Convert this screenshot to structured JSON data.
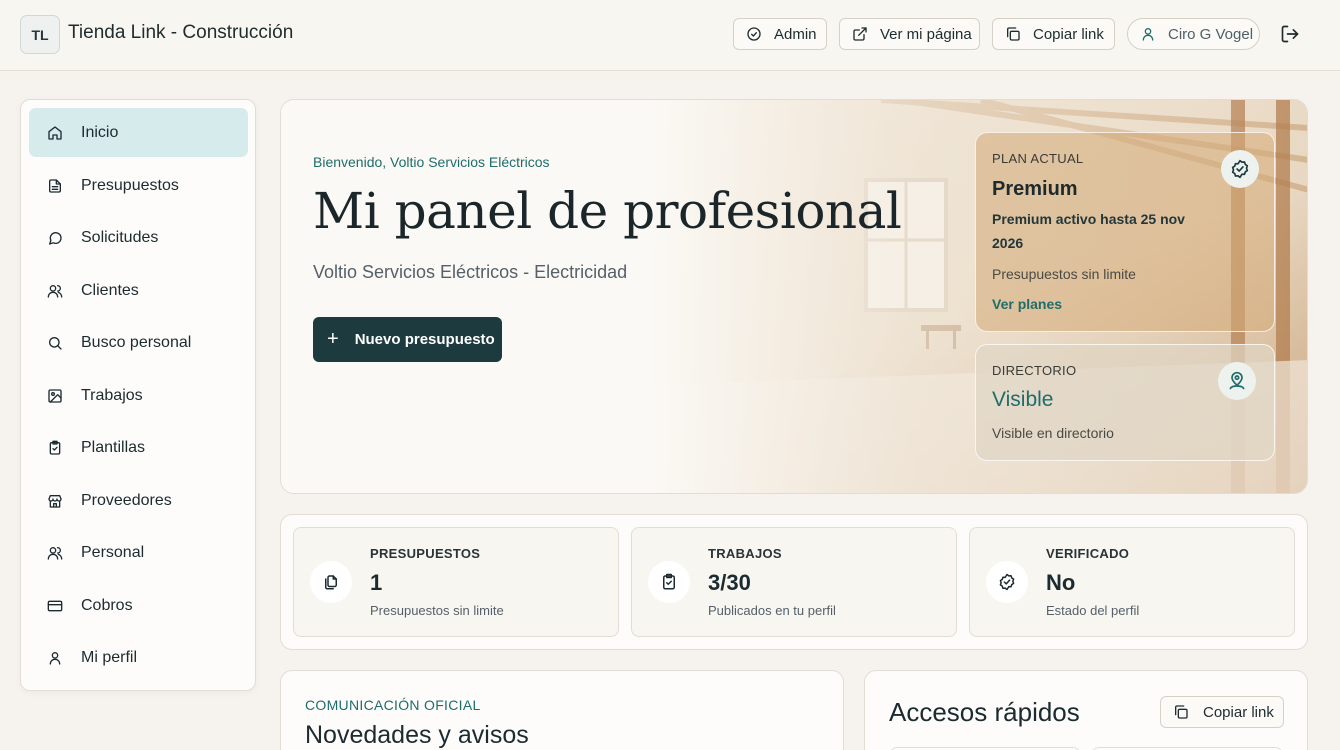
{
  "header": {
    "logo": "TL",
    "title": "Tienda Link - Construcción",
    "admin_label": "Admin",
    "view_page_label": "Ver mi página",
    "copy_link_label": "Copiar link",
    "user_name": "Ciro G Vogel"
  },
  "sidebar": {
    "items": [
      {
        "label": "Inicio",
        "icon": "home-icon",
        "active": true
      },
      {
        "label": "Presupuestos",
        "icon": "file-text-icon"
      },
      {
        "label": "Solicitudes",
        "icon": "message-icon"
      },
      {
        "label": "Clientes",
        "icon": "users-icon"
      },
      {
        "label": "Busco personal",
        "icon": "search-icon"
      },
      {
        "label": "Trabajos",
        "icon": "image-icon"
      },
      {
        "label": "Plantillas",
        "icon": "clipboard-check-icon"
      },
      {
        "label": "Proveedores",
        "icon": "store-icon"
      },
      {
        "label": "Personal",
        "icon": "users-icon"
      },
      {
        "label": "Cobros",
        "icon": "credit-card-icon"
      },
      {
        "label": "Mi perfil",
        "icon": "user-icon"
      }
    ]
  },
  "hero": {
    "welcome": "Bienvenido, Voltio Servicios Eléctricos",
    "title": "Mi panel de profesional",
    "subtitle": "Voltio Servicios Eléctricos - Electricidad",
    "new_button": "Nuevo presupuesto",
    "new_button_icon": "+",
    "plan": {
      "label": "PLAN ACTUAL",
      "name": "Premium",
      "active_line1": "Premium activo hasta 25 nov",
      "active_line2": "2026",
      "note": "Presupuestos sin limite",
      "link": "Ver planes"
    },
    "directory": {
      "label": "DIRECTORIO",
      "status": "Visible",
      "note": "Visible en directorio"
    }
  },
  "stats": [
    {
      "label": "PRESUPUESTOS",
      "value": "1",
      "note": "Presupuestos sin limite",
      "icon": "copy-files-icon"
    },
    {
      "label": "TRABAJOS",
      "value": "3/30",
      "note": "Publicados en tu perfil",
      "icon": "clipboard-check-icon"
    },
    {
      "label": "VERIFICADO",
      "value": "No",
      "note": "Estado del perfil",
      "icon": "badge-check-icon"
    }
  ],
  "news": {
    "kicker": "COMUNICACIÓN OFICIAL",
    "title": "Novedades y avisos"
  },
  "quick": {
    "title": "Accesos rápidos",
    "copy_label": "Copiar link"
  },
  "colors": {
    "accent": "#1f6d6a",
    "primary_button": "#1d3a3f",
    "active_nav": "#d5ebec"
  }
}
